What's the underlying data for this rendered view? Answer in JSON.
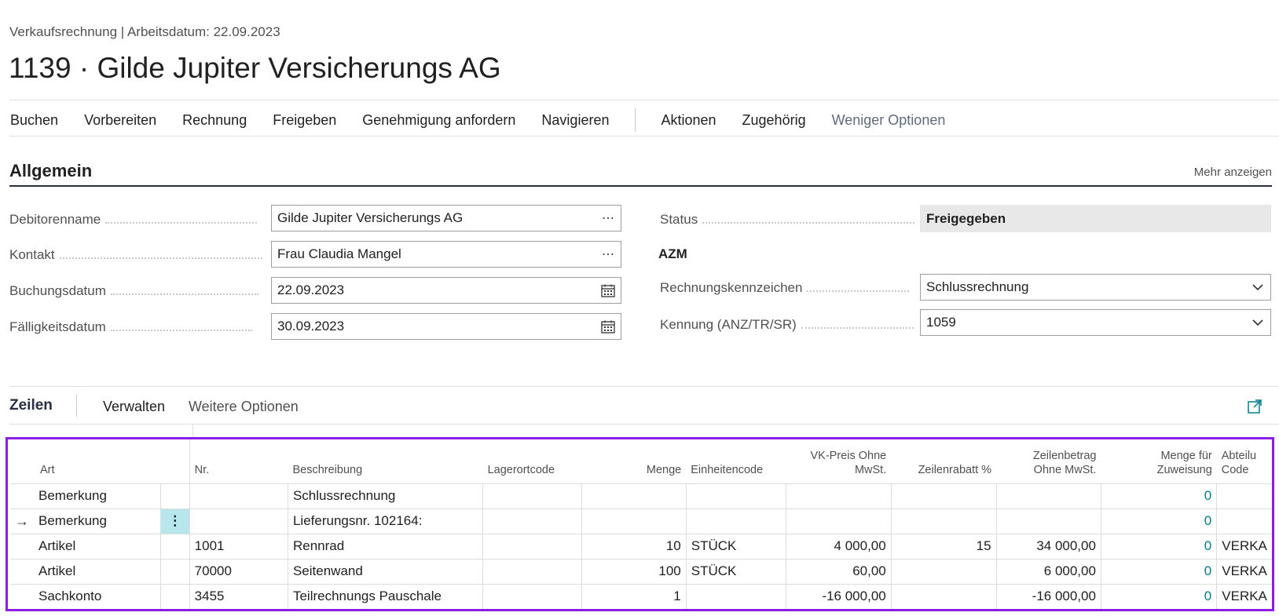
{
  "header": {
    "breadcrumb": "Verkaufsrechnung | Arbeitsdatum: 22.09.2023",
    "title": "1139 · Gilde Jupiter Versicherungs AG"
  },
  "actions": [
    "Buchen",
    "Vorbereiten",
    "Rechnung",
    "Freigeben",
    "Genehmigung anfordern",
    "Navigieren",
    "Aktionen",
    "Zugehörig",
    "Weniger Optionen"
  ],
  "general": {
    "title": "Allgemein",
    "show_more": "Mehr anzeigen",
    "debitorenname": {
      "label": "Debitorenname",
      "value": "Gilde Jupiter Versicherungs AG"
    },
    "kontakt": {
      "label": "Kontakt",
      "value": "Frau Claudia Mangel"
    },
    "buchungsdatum": {
      "label": "Buchungsdatum",
      "value": "22.09.2023"
    },
    "faelligkeitsdatum": {
      "label": "Fälligkeitsdatum",
      "value": "30.09.2023"
    },
    "status": {
      "label": "Status",
      "value": "Freigegeben"
    },
    "azm": "AZM",
    "rechnungskennzeichen": {
      "label": "Rechnungskennzeichen",
      "value": "Schlussrechnung"
    },
    "kennung": {
      "label": "Kennung (ANZ/TR/SR)",
      "value": "1059"
    }
  },
  "lines": {
    "title": "Zeilen",
    "manage": "Verwalten",
    "more_options": "Weitere Optionen",
    "columns": {
      "art": "Art",
      "nr": "Nr.",
      "beschreibung": "Beschreibung",
      "lagerortcode": "Lagerortcode",
      "menge": "Menge",
      "einheitencode": "Einheitencode",
      "vk_preis_1": "VK-Preis Ohne",
      "vk_preis_2": "MwSt.",
      "zeilenrabatt": "Zeilenrabatt %",
      "zeilenbetrag_1": "Zeilenbetrag",
      "zeilenbetrag_2": "Ohne MwSt.",
      "menge_zuweisung_1": "Menge für",
      "menge_zuweisung_2": "Zuweisung",
      "abteilung_1": "Abteilu",
      "abteilung_2": "Code"
    },
    "rows": [
      {
        "art": "Bemerkung",
        "nr": "",
        "beschreibung": "Schlussrechnung",
        "lager": "",
        "menge": "",
        "einheit": "",
        "vk": "",
        "rabatt": "",
        "betrag": "",
        "zuweisung": "0",
        "abteilung": ""
      },
      {
        "art": "Bemerkung",
        "nr": "",
        "beschreibung": "Lieferungsnr. 102164:",
        "lager": "",
        "menge": "",
        "einheit": "",
        "vk": "",
        "rabatt": "",
        "betrag": "",
        "zuweisung": "0",
        "abteilung": ""
      },
      {
        "art": "Artikel",
        "nr": "1001",
        "beschreibung": "Rennrad",
        "lager": "",
        "menge": "10",
        "einheit": "STÜCK",
        "vk": "4 000,00",
        "rabatt": "15",
        "betrag": "34 000,00",
        "zuweisung": "0",
        "abteilung": "VERKA"
      },
      {
        "art": "Artikel",
        "nr": "70000",
        "beschreibung": "Seitenwand",
        "lager": "",
        "menge": "100",
        "einheit": "STÜCK",
        "vk": "60,00",
        "rabatt": "",
        "betrag": "6 000,00",
        "zuweisung": "0",
        "abteilung": "VERKA"
      },
      {
        "art": "Sachkonto",
        "nr": "3455",
        "beschreibung": "Teilrechnungs Pauschale",
        "lager": "",
        "menge": "1",
        "einheit": "",
        "vk": "-16 000,00",
        "rabatt": "",
        "betrag": "-16 000,00",
        "zuweisung": "0",
        "abteilung": "VERKA"
      }
    ]
  }
}
